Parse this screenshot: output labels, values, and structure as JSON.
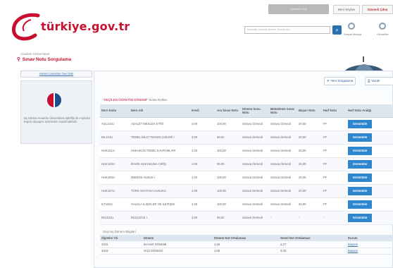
{
  "topbar": {
    "grey_label": "Sisteme Giriş",
    "buttons": [
      {
        "label": "Beni Seyfan"
      },
      {
        "label": "Güvenli Çıkış"
      }
    ]
  },
  "header": {
    "logo_text": "türkiye.gov.tr",
    "search_placeholder": "Kurumlar, Anahtar Kelime, Hizmet Ara",
    "icons": [
      {
        "label": "Sosyal Medya",
        "icon": "social-icon"
      },
      {
        "label": "Hizmetler",
        "icon": "services-icon"
      }
    ]
  },
  "page": {
    "institution": "Anadolu Üniversitesi",
    "title": "Sınav Notu Sorgulama"
  },
  "sidebar": {
    "link": "Hizmet Listesine Geri Dön",
    "description": "Bu hizmet Anadolu Üniversitesi işbirliği ile e-Devlet Kapısı altyapısı üzerinden sunulmaktadır."
  },
  "toolbar": {
    "new_query": "Yeni Sorgulama",
    "print": "Yazdır"
  },
  "grades": {
    "section_prefix": "SEÇİLEN ÖĞRETİM DÖNEMİ",
    "section_suffix": "Sınav Notları",
    "columns": [
      "Ders Kodu",
      "Ders Adı",
      "Kredi",
      "Ara Sınav Notu",
      "Dönem Sonu Notu",
      "Bütünleme Sınav Notu",
      "Başarı Notu",
      "Harf Notu",
      "Harf Notu Aralığı"
    ],
    "view_label": "Görüntüle",
    "rows": [
      {
        "code": "ADL101U",
        "name": "ADALET MESLEK ETİĞİ",
        "credit": "4.00",
        "mid": "100,00",
        "final": "Sınava Girmedi",
        "makeup": "Sınava Girmedi",
        "score": "20,00",
        "letter": "FF"
      },
      {
        "code": "BIL101U",
        "name": "TEMEL BİLGİ TEKNOLOJİLERİ I",
        "credit": "3.00",
        "mid": "96,00",
        "final": "Sınava Girmedi",
        "makeup": "Sınava Girmedi",
        "score": "20,00",
        "letter": "FF"
      },
      {
        "code": "HUK101U",
        "name": "HUKUKUN TEMEL KAVRAMLARI",
        "credit": "4.00",
        "mid": "100,00",
        "final": "Sınava Girmedi",
        "makeup": "Sınava Girmedi",
        "score": "20,00",
        "letter": "FF"
      },
      {
        "code": "HUK103U",
        "name": "İDARE HUKUKUNA GİRİŞ",
        "credit": "4.00",
        "mid": "96,00",
        "final": "Sınava Girmedi",
        "makeup": "Sınava Girmedi",
        "score": "20,00",
        "letter": "FF"
      },
      {
        "code": "HUK105U",
        "name": "MEDENİ HUKUK I",
        "credit": "4.00",
        "mid": "100,00",
        "final": "Sınava Girmedi",
        "makeup": "Sınava Girmedi",
        "score": "20,00",
        "letter": "FF"
      },
      {
        "code": "HUK107U",
        "name": "TÜRK ANAYASA HUKUKU",
        "credit": "4.00",
        "mid": "100,00",
        "final": "Sınava Girmedi",
        "makeup": "Sınava Girmedi",
        "score": "20,00",
        "letter": "FF"
      },
      {
        "code": "ILT103U",
        "name": "HALKLA İLİŞKİLER VE İLETİŞİM",
        "credit": "4.00",
        "mid": "100,00",
        "final": "Sınava Girmedi",
        "makeup": "Sınava Girmedi",
        "score": "20,00",
        "letter": "FF"
      },
      {
        "code": "ING101U",
        "name": "İNGİLİZCE I",
        "credit": "3.00",
        "mid": "96,00",
        "final": "Sınava Girmedi",
        "makeup": "-",
        "score": "-",
        "letter": "-"
      }
    ]
  },
  "past": {
    "title": "Geçmiş Dönem Bilgileri",
    "columns": [
      "Öğretim Yılı",
      "Dönem",
      "Dönem Not Ortalaması",
      "Genel Not Ortalaması",
      "Durum"
    ],
    "rows": [
      {
        "year": "2016",
        "term": "BAHAR DÖNEMİ",
        "term_avg": "2,58",
        "general_avg": "2,27",
        "status": "Başarılı"
      },
      {
        "year": "2016",
        "term": "GÜZ DÖNEMİ",
        "term_avg": "3,05",
        "general_avg": "3,05",
        "status": "Başarılı"
      }
    ]
  },
  "colors": {
    "brand_red": "#c8102e",
    "link_blue": "#3b6ea8",
    "button_blue": "#2e86cf"
  }
}
